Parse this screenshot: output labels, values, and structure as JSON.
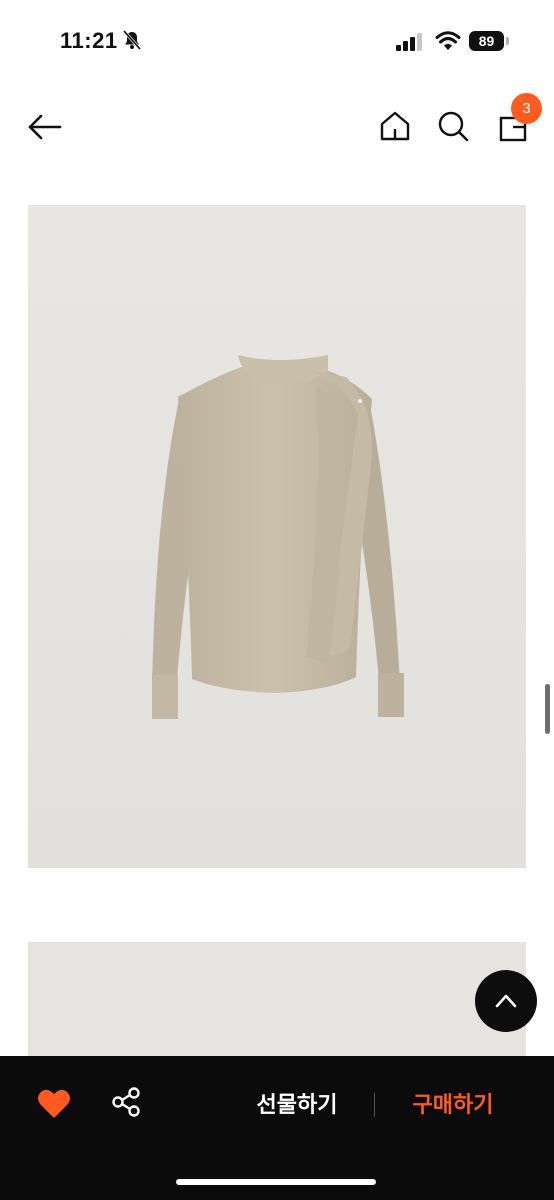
{
  "status_bar": {
    "time": "11:21",
    "battery_level": "89",
    "icons": [
      "bell-slash-icon",
      "signal-icon",
      "wifi-icon",
      "battery-icon"
    ]
  },
  "nav": {
    "icons": [
      "back-arrow-icon",
      "home-icon",
      "search-icon",
      "shopping-bag-icon"
    ],
    "cart_count": "3"
  },
  "bottom_bar": {
    "gift_label": "선물하기",
    "buy_label": "구매하기",
    "icons": [
      "heart-icon",
      "share-icon"
    ]
  },
  "colors": {
    "accent": "#ff5a1f",
    "bottom_bar_bg": "#0b0b0b",
    "product_bg": "#e7e5e1",
    "blouse": "#c6bca8"
  }
}
